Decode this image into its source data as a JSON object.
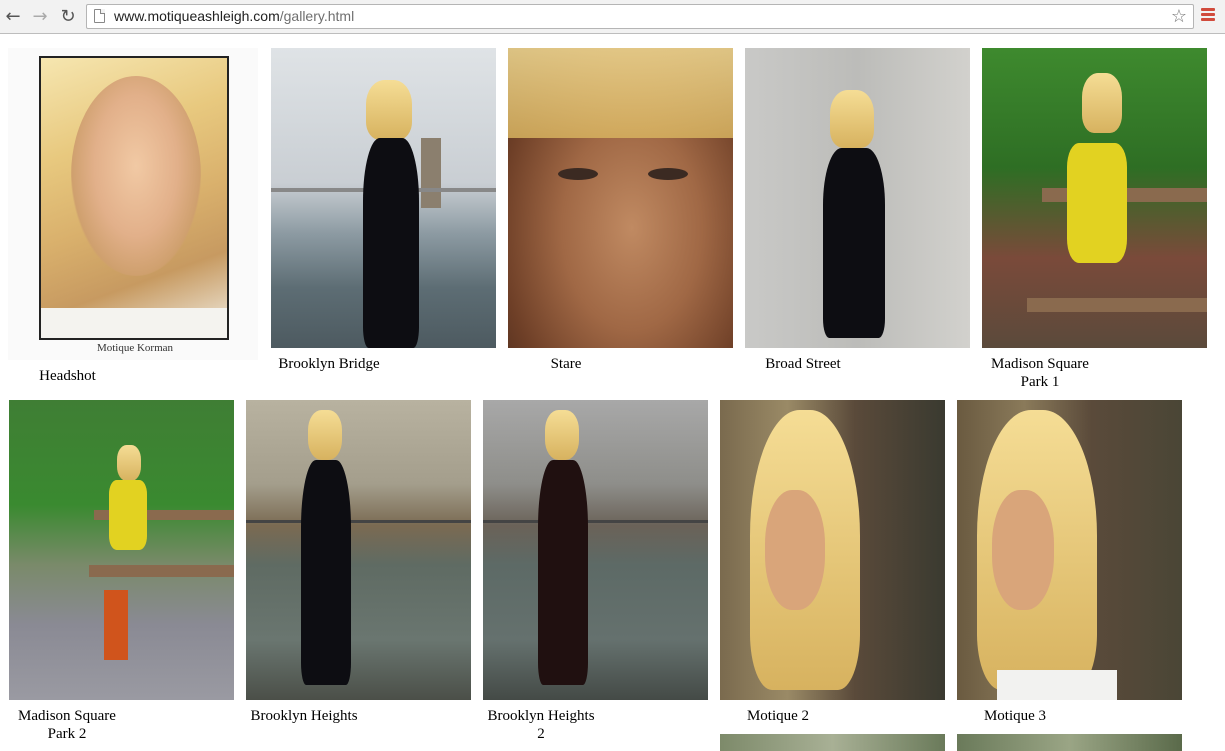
{
  "browser": {
    "url_host": "www.motiqueashleigh.com",
    "url_path": "/gallery.html",
    "back_icon": "arrow-left-icon",
    "forward_icon": "arrow-right-icon",
    "reload_icon": "reload-icon",
    "bookmark_icon": "star-icon",
    "menu_icon": "hamburger-menu-icon"
  },
  "gallery": {
    "headshot": {
      "signature": "Motique Korman",
      "caption": "Headshot"
    },
    "row1": [
      {
        "caption": "Brooklyn Bridge"
      },
      {
        "caption": "Stare"
      },
      {
        "caption": "Broad Street"
      },
      {
        "caption_line1": "Madison Square",
        "caption_line2": "Park 1"
      }
    ],
    "row2": [
      {
        "caption_line1": "Madison Square",
        "caption_line2": "Park 2"
      },
      {
        "caption": "Brooklyn Heights"
      },
      {
        "caption_line1": "Brooklyn Heights",
        "caption_line2": "2"
      },
      {
        "caption": "Motique 2"
      },
      {
        "caption": "Motique 3"
      }
    ]
  },
  "colors": {
    "menu_accent": "#d14b3c"
  }
}
